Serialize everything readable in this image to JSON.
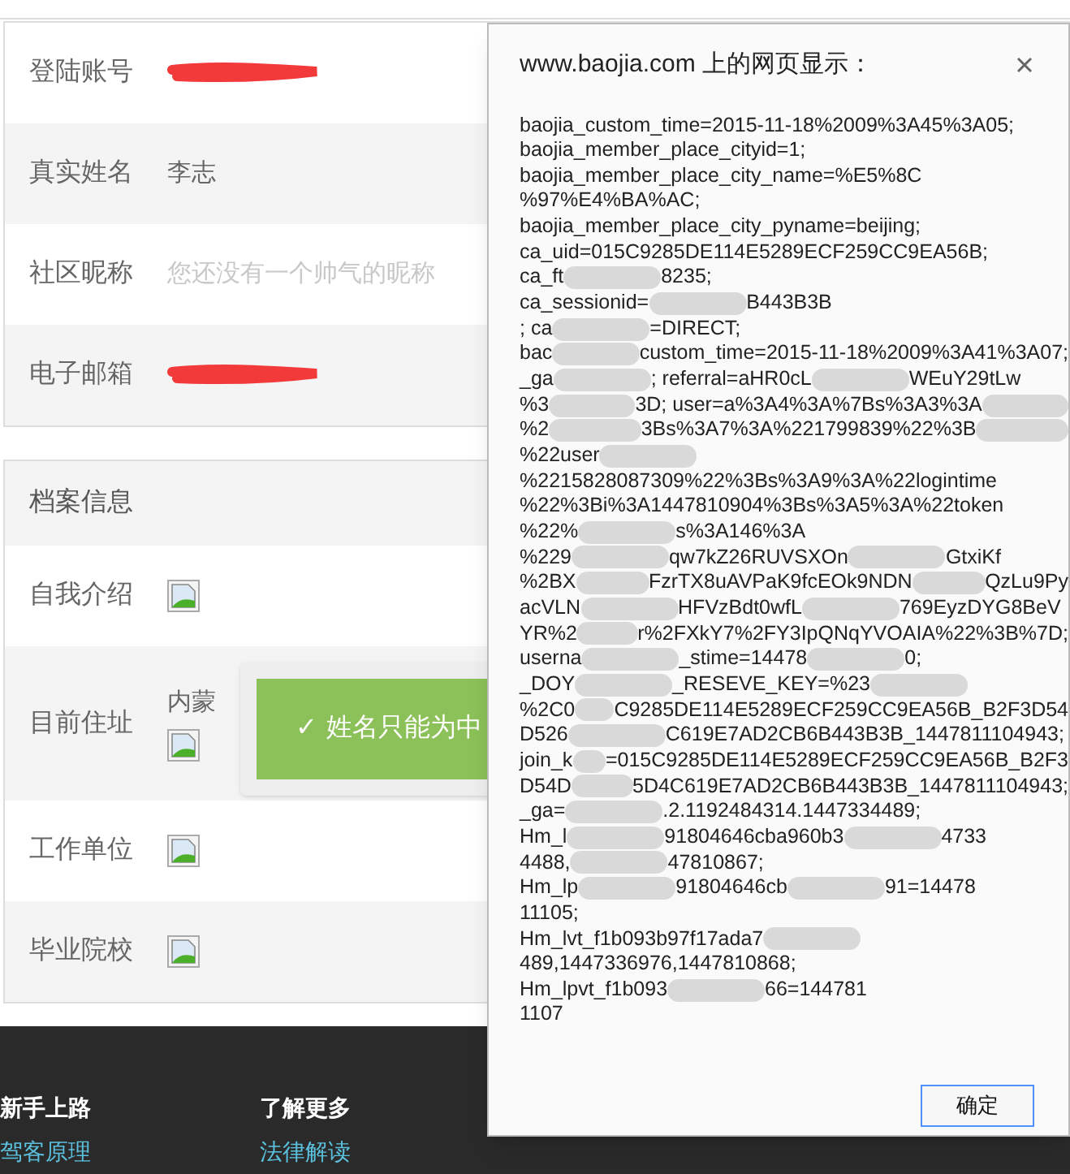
{
  "account_section": {
    "rows": [
      {
        "label": "登陆账号",
        "kind": "scribble"
      },
      {
        "label": "真实姓名",
        "kind": "text",
        "value": "李志"
      },
      {
        "label": "社区昵称",
        "kind": "hint",
        "value": "您还没有一个帅气的昵称"
      },
      {
        "label": "电子邮箱",
        "kind": "scribble"
      }
    ]
  },
  "archive_section": {
    "header": "档案信息",
    "rows": [
      {
        "label": "自我介绍",
        "kind": "image"
      },
      {
        "label": "目前住址",
        "kind": "address",
        "value": "内蒙"
      },
      {
        "label": "工作单位",
        "kind": "image"
      },
      {
        "label": "毕业院校",
        "kind": "image"
      }
    ]
  },
  "toast": {
    "icon": "✓",
    "text": "姓名只能为中"
  },
  "footer": {
    "columns": [
      {
        "heading": "新手上路",
        "link": "驾客原理"
      },
      {
        "heading": "了解更多",
        "link": "法律解读"
      }
    ]
  },
  "dialog": {
    "title": "www.baojia.com 上的网页显示：",
    "button": "确定",
    "lines": [
      [
        {
          "kind": "text",
          "text": "baojia_custom_time=2015-11-18%2009%3A45%3A05;"
        }
      ],
      [
        {
          "kind": "text",
          "text": "baojia_member_place_cityid=1;"
        }
      ],
      [
        {
          "kind": "text",
          "text": "baojia_member_place_city_name=%E5%8C"
        }
      ],
      [
        {
          "kind": "text",
          "text": "%97%E4%BA%AC;"
        }
      ],
      [
        {
          "kind": "text",
          "text": "baojia_member_place_city_pyname=beijing;"
        }
      ],
      [
        {
          "kind": "text",
          "text": "ca_uid=015C9285DE114E5289ECF259CC9EA56B;"
        }
      ],
      [
        {
          "kind": "text",
          "text": "ca_ft"
        },
        {
          "kind": "blur"
        },
        {
          "kind": "text",
          "text": "8235;"
        }
      ],
      [
        {
          "kind": "text",
          "text": "ca_sessionid="
        },
        {
          "kind": "blur"
        },
        {
          "kind": "text",
          "text": "B443B3B"
        }
      ],
      [
        {
          "kind": "text",
          "text": "; ca"
        },
        {
          "kind": "blur"
        },
        {
          "kind": "text",
          "text": "=DIRECT;"
        }
      ],
      [
        {
          "kind": "text",
          "text": "bac"
        },
        {
          "kind": "blur"
        },
        {
          "kind": "text",
          "text": "custom_time=2015-11-18%2009%3A41%3A07;"
        }
      ],
      [
        {
          "kind": "text",
          "text": "_ga"
        },
        {
          "kind": "blur"
        },
        {
          "kind": "text",
          "text": "; referral=aHR0cL"
        },
        {
          "kind": "blur"
        },
        {
          "kind": "text",
          "text": "WEuY29tLw"
        }
      ],
      [
        {
          "kind": "text",
          "text": "%3"
        },
        {
          "kind": "blur"
        },
        {
          "kind": "text",
          "text": "3D; user=a%3A4%3A%7Bs%3A3%3A"
        },
        {
          "kind": "blur"
        }
      ],
      [
        {
          "kind": "text",
          "text": "%2"
        },
        {
          "kind": "blur"
        },
        {
          "kind": "text",
          "text": "3Bs%3A7%3A%221799839%22%3B"
        },
        {
          "kind": "blur"
        }
      ],
      [
        {
          "kind": "text",
          "text": "%22user"
        },
        {
          "kind": "blur"
        }
      ],
      [
        {
          "kind": "text",
          "text": "%2215828087309%22%3Bs%3A9%3A%22logintime"
        }
      ],
      [
        {
          "kind": "text",
          "text": "%22%3Bi%3A1447810904%3Bs%3A5%3A%22token"
        }
      ],
      [
        {
          "kind": "text",
          "text": "%22%"
        },
        {
          "kind": "blur"
        },
        {
          "kind": "text",
          "text": "s%3A146%3A"
        }
      ],
      [
        {
          "kind": "text",
          "text": "%229"
        },
        {
          "kind": "blur"
        },
        {
          "kind": "text",
          "text": "qw7kZ26RUVSXOn"
        },
        {
          "kind": "blur"
        },
        {
          "kind": "text",
          "text": "GtxiKf"
        }
      ],
      [
        {
          "kind": "text",
          "text": "%2BX"
        },
        {
          "kind": "blur"
        },
        {
          "kind": "text",
          "text": "FzrTX8uAVPaK9fcEOk9NDN"
        },
        {
          "kind": "blur"
        },
        {
          "kind": "text",
          "text": "QzLu9Py"
        }
      ],
      [
        {
          "kind": "text",
          "text": "acVLN"
        },
        {
          "kind": "blur"
        },
        {
          "kind": "text",
          "text": "HFVzBdt0wfL"
        },
        {
          "kind": "blur"
        },
        {
          "kind": "text",
          "text": "769EyzDYG8BeV"
        }
      ],
      [
        {
          "kind": "text",
          "text": "YR%2"
        },
        {
          "kind": "blur"
        },
        {
          "kind": "text",
          "text": "r%2FXkY7%2FY3IpQNqYVOAIA%22%3B%7D;"
        }
      ],
      [
        {
          "kind": "text",
          "text": "userna"
        },
        {
          "kind": "blur"
        },
        {
          "kind": "text",
          "text": "_stime=14478"
        },
        {
          "kind": "blur"
        },
        {
          "kind": "text",
          "text": "0;"
        }
      ],
      [
        {
          "kind": "text",
          "text": "_DOY"
        },
        {
          "kind": "blur"
        },
        {
          "kind": "text",
          "text": "_RESEVE_KEY=%23"
        },
        {
          "kind": "blur"
        }
      ],
      [
        {
          "kind": "text",
          "text": "%2C0"
        },
        {
          "kind": "blur"
        },
        {
          "kind": "text",
          "text": "C9285DE114E5289ECF259CC9EA56B_B2F3D54"
        }
      ],
      [
        {
          "kind": "text",
          "text": "D526"
        },
        {
          "kind": "blur"
        },
        {
          "kind": "text",
          "text": "C619E7AD2CB6B443B3B_1447811104943;"
        }
      ],
      [
        {
          "kind": "text",
          "text": "join_k"
        },
        {
          "kind": "blur"
        },
        {
          "kind": "text",
          "text": "=015C9285DE114E5289ECF259CC9EA56B_B2F3"
        }
      ],
      [
        {
          "kind": "text",
          "text": "D54D"
        },
        {
          "kind": "blur"
        },
        {
          "kind": "text",
          "text": "5D4C619E7AD2CB6B443B3B_1447811104943;"
        }
      ],
      [
        {
          "kind": "text",
          "text": "_ga="
        },
        {
          "kind": "blur"
        },
        {
          "kind": "text",
          "text": ".2.1192484314.1447334489;"
        }
      ],
      [
        {
          "kind": "text",
          "text": "Hm_l"
        },
        {
          "kind": "blur"
        },
        {
          "kind": "text",
          "text": "91804646cba960b3"
        },
        {
          "kind": "blur"
        },
        {
          "kind": "text",
          "text": "4733"
        }
      ],
      [
        {
          "kind": "text",
          "text": "4488,"
        },
        {
          "kind": "blur"
        },
        {
          "kind": "text",
          "text": "47810867;"
        }
      ],
      [
        {
          "kind": "text",
          "text": "Hm_lp"
        },
        {
          "kind": "blur"
        },
        {
          "kind": "text",
          "text": "91804646cb"
        },
        {
          "kind": "blur"
        },
        {
          "kind": "text",
          "text": "91=14478"
        }
      ],
      [
        {
          "kind": "text",
          "text": "11105;"
        }
      ],
      [
        {
          "kind": "text",
          "text": "Hm_lvt_f1b093b97f17ada7"
        },
        {
          "kind": "blur"
        }
      ],
      [
        {
          "kind": "text",
          "text": "489,1447336976,1447810868;"
        }
      ],
      [
        {
          "kind": "text",
          "text": "Hm_lpvt_f1b093"
        },
        {
          "kind": "blur"
        },
        {
          "kind": "text",
          "text": "66=144781"
        }
      ],
      [
        {
          "kind": "text",
          "text": "1107"
        }
      ]
    ]
  }
}
